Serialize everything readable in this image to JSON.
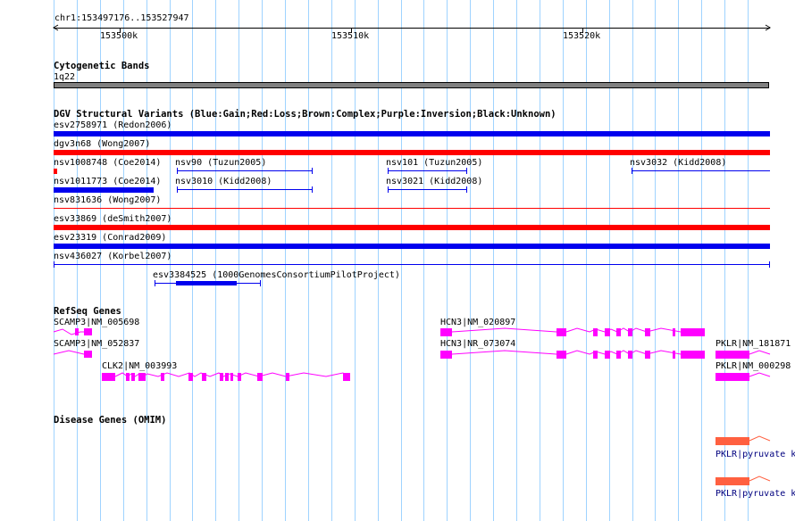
{
  "ruler": {
    "position_label": "chr1:153497176..153527947",
    "tick_labels": [
      "153500k",
      "153510k",
      "153520k"
    ]
  },
  "tracks": {
    "cytogenetic": {
      "title": "Cytogenetic Bands",
      "band_label": "1q22"
    },
    "dgv": {
      "title": "DGV Structural Variants (Blue:Gain;Red:Loss;Brown:Complex;Purple:Inversion;Black:Unknown)",
      "features": [
        {
          "label": "esv2758971 (Redon2006)",
          "type": "gain",
          "color": "#0000ee"
        },
        {
          "label": "dgv3n68 (Wong2007)",
          "type": "loss",
          "color": "#ff0000"
        },
        {
          "label": "nsv1008748 (Coe2014)",
          "type": "loss",
          "color": "#ff0000"
        },
        {
          "label": "nsv90 (Tuzun2005)",
          "type": "gain",
          "color": "#0000ee"
        },
        {
          "label": "nsv101 (Tuzun2005)",
          "type": "gain",
          "color": "#0000ee"
        },
        {
          "label": "nsv3032 (Kidd2008)",
          "type": "gain",
          "color": "#0000ee"
        },
        {
          "label": "nsv1011773 (Coe2014)",
          "type": "gain",
          "color": "#0000ee"
        },
        {
          "label": "nsv3010 (Kidd2008)",
          "type": "gain",
          "color": "#0000ee"
        },
        {
          "label": "nsv3021 (Kidd2008)",
          "type": "gain",
          "color": "#0000ee"
        },
        {
          "label": "nsv831636 (Wong2007)",
          "type": "loss",
          "color": "#ff0000"
        },
        {
          "label": "esv33869 (deSmith2007)",
          "type": "loss",
          "color": "#ff0000"
        },
        {
          "label": "esv23319 (Conrad2009)",
          "type": "gain",
          "color": "#0000ee"
        },
        {
          "label": "nsv436027 (Korbel2007)",
          "type": "gain",
          "color": "#0000ee"
        },
        {
          "label": "esv3384525 (1000GenomesConsortiumPilotProject)",
          "type": "gain",
          "color": "#0000ee"
        }
      ]
    },
    "refseq": {
      "title": "RefSeq Genes",
      "color": "#ff00ff",
      "genes": [
        {
          "label": "SCAMP3|NM_005698"
        },
        {
          "label": "SCAMP3|NM_052837"
        },
        {
          "label": "CLK2|NM_003993"
        },
        {
          "label": "HCN3|NM_020897"
        },
        {
          "label": "HCN3|NR_073074"
        },
        {
          "label": "PKLR|NM_181871"
        },
        {
          "label": "PKLR|NM_000298"
        }
      ]
    },
    "omim": {
      "title": "Disease Genes (OMIM)",
      "color": "#ff6040",
      "label_color": "#00007f",
      "genes": [
        {
          "label": "PKLR|pyruvate k"
        },
        {
          "label": "PKLR|pyruvate k"
        }
      ]
    }
  }
}
